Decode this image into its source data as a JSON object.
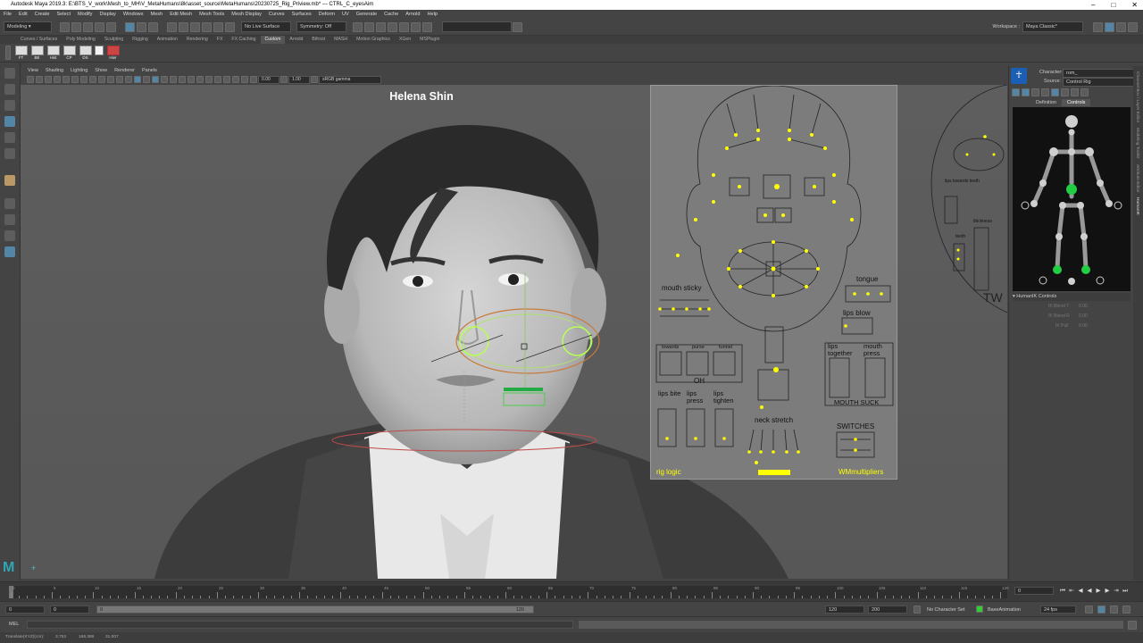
{
  "app": {
    "title": "Autodesk Maya 2019.3: E:\\BTS_V_work\\Mesh_to_MH\\V_MetaHumans\\8k\\asset_source\\MetaHumans\\20230725_Rig_Priview.mb*  ---  CTRL_C_eyesAim"
  },
  "menu": [
    "File",
    "Edit",
    "Create",
    "Select",
    "Modify",
    "Display",
    "Windows",
    "Mesh",
    "Edit Mesh",
    "Mesh Tools",
    "Mesh Display",
    "Curves",
    "Surfaces",
    "Deform",
    "UV",
    "Generate",
    "Cache",
    "Arnold",
    "Help"
  ],
  "statusline": {
    "mode": "Modeling",
    "live_surface": "No Live Surface",
    "symmetry": "Symmetry: Off",
    "workspace_label": "Workspace :",
    "workspace": "Maya Classic*"
  },
  "shelf_tabs": [
    "Curves / Surfaces",
    "Poly Modeling",
    "Sculpting",
    "Rigging",
    "Animation",
    "Rendering",
    "FX",
    "FX Caching",
    "Custom",
    "Arnold",
    "Bifrost",
    "MASH",
    "Motion Graphics",
    "XGen",
    "MSPlugin"
  ],
  "shelf_active": "Custom",
  "shelf_buttons": [
    "FT",
    "BE",
    "Hist",
    "CP",
    "DS",
    "Hier"
  ],
  "viewport_menu": [
    "View",
    "Shading",
    "Lighting",
    "Show",
    "Renderer",
    "Panels"
  ],
  "viewport_toolbar": {
    "exposure": "0.00",
    "gamma": "1.00",
    "colorspace": "sRGB gamma"
  },
  "viewport_caption": "Helena Shin",
  "rig_labels": {
    "mouth_sticky": "mouth sticky",
    "tongue": "tongue",
    "lips_blow": "lips blow",
    "towards": "towards",
    "purse": "purse",
    "funnel": "funnel",
    "oh": "OH",
    "lips_together": "lips together",
    "mouth_press": "mouth press",
    "mouth_suck": "MOUTH SUCK",
    "lips_bite": "lips bite",
    "lips_press": "lips press",
    "lips_tighten": "lips tighten",
    "neck_stretch": "neck stretch",
    "switches": "SWITCHES",
    "rig_logic": "rig logic",
    "wm": "WMmultipliers",
    "lips_towards_teeth": "lips towards teeth",
    "thickness": "thickness",
    "teeth": "teeth",
    "tw": "TW"
  },
  "humanik": {
    "character_label": "Character:",
    "character": "rom_",
    "source_label": "Source:",
    "source": "Control Rig",
    "tabs": [
      "Definition",
      "Controls"
    ],
    "controls_header": "HumanIK Controls",
    "ik_rows": [
      {
        "label": "IK Blend T",
        "value": "0.00"
      },
      {
        "label": "IK Blend R",
        "value": "0.00"
      },
      {
        "label": "IK Pull",
        "value": "0.00"
      }
    ]
  },
  "side_tabs": [
    "Channel Box / Layer Editor",
    "Modeling Toolkit",
    "Attribute Editor",
    "HumanIK"
  ],
  "timeline": {
    "ticks": [
      "0",
      "5",
      "10",
      "15",
      "20",
      "25",
      "30",
      "35",
      "40",
      "45",
      "50",
      "55",
      "60",
      "65",
      "70",
      "75",
      "80",
      "85",
      "90",
      "95",
      "100",
      "105",
      "110",
      "115",
      "120"
    ],
    "current": "0"
  },
  "range": {
    "start": "0",
    "inner_start": "0",
    "inner_handle": "0",
    "inner_end": "120",
    "end": "120",
    "outer_end": "200",
    "character_set": "No Character Set",
    "anim_layer": "BaseAnimation",
    "fps": "24 fps"
  },
  "cmdline": {
    "label": "MEL"
  },
  "helpline": {
    "text": "Translate(XYZ)(cm):",
    "x": "3.753",
    "y": "168.386",
    "z": "31.007"
  },
  "colors": {
    "accent": "#5285a6",
    "rig_dot": "#ffff00",
    "select_green": "#00ff55"
  }
}
